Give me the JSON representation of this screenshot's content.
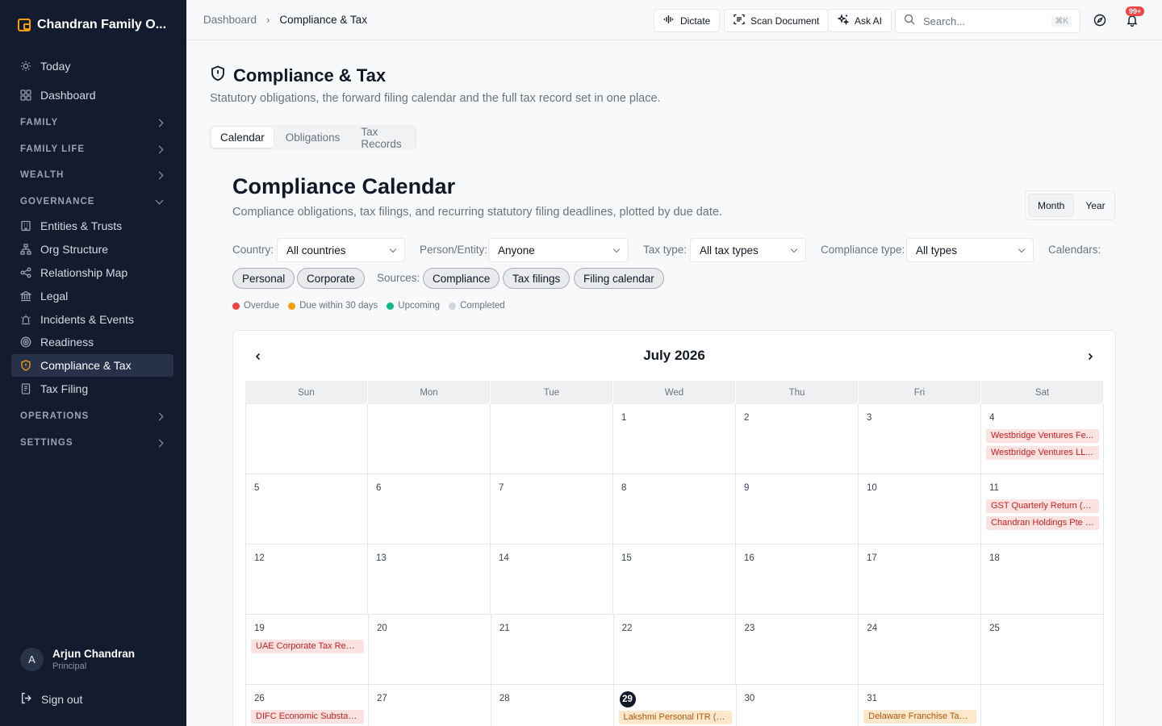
{
  "sidebar": {
    "brand": "Chandran Family O...",
    "top_items": [
      {
        "label": "Today",
        "icon": "sun-icon"
      },
      {
        "label": "Dashboard",
        "icon": "grid-icon"
      }
    ],
    "groups": {
      "family": "FAMILY",
      "family_life": "FAMILY LIFE",
      "wealth": "WEALTH",
      "governance": "GOVERNANCE",
      "operations": "OPERATIONS",
      "settings": "SETTINGS"
    },
    "governance_items": [
      {
        "label": "Entities & Trusts",
        "icon": "building-icon"
      },
      {
        "label": "Org Structure",
        "icon": "org-chart-icon"
      },
      {
        "label": "Relationship Map",
        "icon": "share-icon"
      },
      {
        "label": "Legal",
        "icon": "landmark-icon"
      },
      {
        "label": "Incidents & Events",
        "icon": "siren-icon"
      },
      {
        "label": "Readiness",
        "icon": "target-icon"
      },
      {
        "label": "Compliance & Tax",
        "icon": "shield-icon"
      },
      {
        "label": "Tax Filing",
        "icon": "receipt-icon"
      }
    ],
    "user": {
      "initial": "A",
      "name": "Arjun Chandran",
      "role": "Principal"
    },
    "signout": "Sign out"
  },
  "topbar": {
    "breadcrumb": [
      "Dashboard",
      "Compliance & Tax"
    ],
    "dictate": "Dictate",
    "scan": "Scan Document",
    "ask_ai": "Ask AI",
    "search_placeholder": "Search...",
    "search_kbd": "⌘K",
    "notifications": "99+"
  },
  "page": {
    "title": "Compliance & Tax",
    "subtitle": "Statutory obligations, the forward filing calendar and the full tax record set in one place.",
    "tabs": [
      "Calendar",
      "Obligations",
      "Tax Records"
    ]
  },
  "calendar": {
    "title": "Compliance Calendar",
    "subtitle": "Compliance obligations, tax filings, and recurring statutory filing deadlines, plotted by due date.",
    "views": [
      "Month",
      "Year"
    ],
    "filters": {
      "country_label": "Country:",
      "country_value": "All countries",
      "person_label": "Person/Entity:",
      "person_value": "Anyone",
      "tax_label": "Tax type:",
      "tax_value": "All tax types",
      "compliance_label": "Compliance type:",
      "compliance_value": "All types",
      "calendars_label": "Calendars:"
    },
    "calendar_chips": [
      "Personal",
      "Corporate"
    ],
    "sources_label": "Sources:",
    "source_chips": [
      "Compliance",
      "Tax filings",
      "Filing calendar"
    ],
    "legend": [
      {
        "label": "Overdue",
        "color": "#ef4444"
      },
      {
        "label": "Due within 30 days",
        "color": "#f59e0b"
      },
      {
        "label": "Upcoming",
        "color": "#10b981"
      },
      {
        "label": "Completed",
        "color": "#d1d5db"
      }
    ],
    "month": "July 2026",
    "weekdays": [
      "Sun",
      "Mon",
      "Tue",
      "Wed",
      "Thu",
      "Fri",
      "Sat"
    ],
    "weeks": [
      [
        {
          "day": ""
        },
        {
          "day": ""
        },
        {
          "day": ""
        },
        {
          "day": "1"
        },
        {
          "day": "2"
        },
        {
          "day": "3"
        },
        {
          "day": "4",
          "events": [
            {
              "label": "Westbridge Ventures Fe...",
              "status": "overdue"
            },
            {
              "label": "Westbridge Ventures LL...",
              "status": "overdue"
            }
          ]
        }
      ],
      [
        {
          "day": "5"
        },
        {
          "day": "6"
        },
        {
          "day": "7"
        },
        {
          "day": "8"
        },
        {
          "day": "9"
        },
        {
          "day": "10"
        },
        {
          "day": "11",
          "events": [
            {
              "label": "GST Quarterly Return (G...",
              "status": "overdue"
            },
            {
              "label": "Chandran Holdings Pte L...",
              "status": "overdue"
            }
          ]
        }
      ],
      [
        {
          "day": "12"
        },
        {
          "day": "13"
        },
        {
          "day": "14"
        },
        {
          "day": "15"
        },
        {
          "day": "16"
        },
        {
          "day": "17"
        },
        {
          "day": "18"
        }
      ],
      [
        {
          "day": "19",
          "events": [
            {
              "label": "UAE Corporate Tax Regi...",
              "status": "overdue"
            }
          ]
        },
        {
          "day": "20"
        },
        {
          "day": "21"
        },
        {
          "day": "22"
        },
        {
          "day": "23"
        },
        {
          "day": "24"
        },
        {
          "day": "25"
        }
      ],
      [
        {
          "day": "26",
          "events": [
            {
              "label": "DIFC Economic Substan...",
              "status": "overdue"
            }
          ]
        },
        {
          "day": "27"
        },
        {
          "day": "28"
        },
        {
          "day": "29",
          "today": true,
          "events": [
            {
              "label": "Lakshmi Personal ITR (IT...",
              "status": "due"
            }
          ]
        },
        {
          "day": "30"
        },
        {
          "day": "31",
          "events": [
            {
              "label": "Delaware Franchise Tax ...",
              "status": "due"
            }
          ]
        },
        {
          "day": ""
        }
      ]
    ]
  }
}
